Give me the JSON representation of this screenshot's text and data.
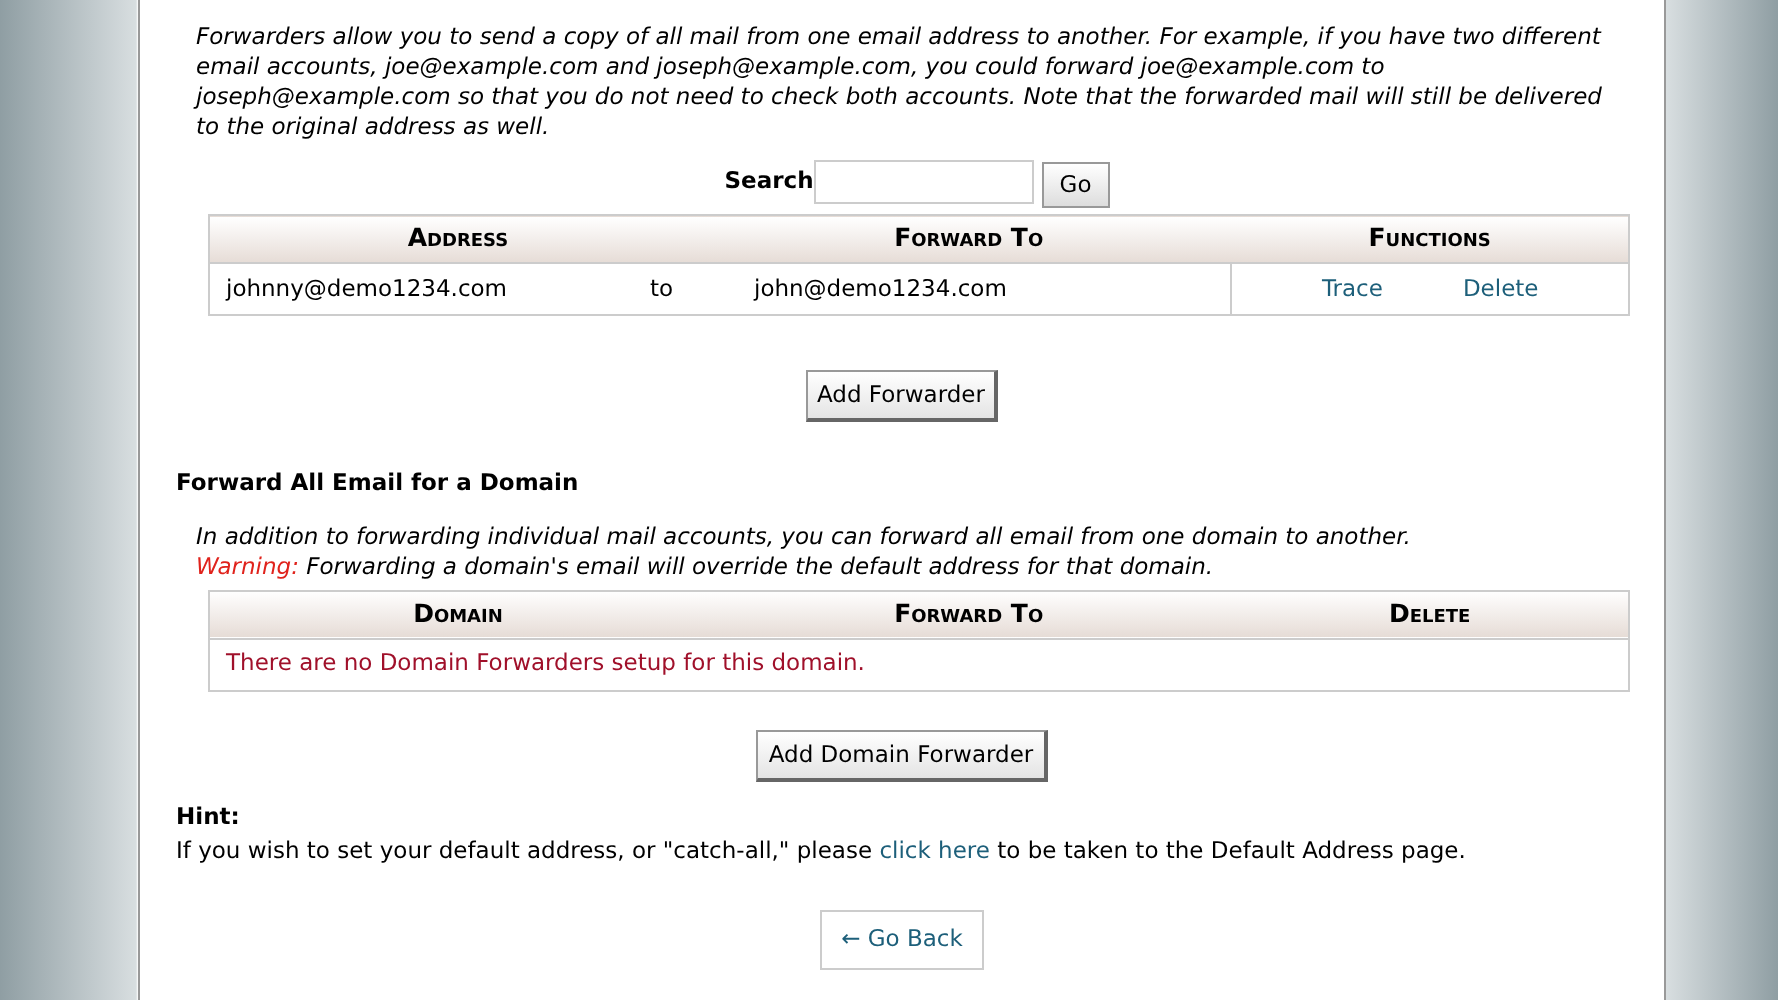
{
  "intro": "Forwarders allow you to send a copy of all mail from one email address to another. For example, if you have two different email accounts, joe@example.com and joseph@example.com, you could forward joe@example.com to joseph@example.com so that you do not need to check both accounts. Note that the forwarded mail will still be delivered to the original address as well.",
  "search": {
    "label": "Search",
    "button": "Go"
  },
  "forwarders": {
    "columns": [
      "Address",
      "Forward To",
      "Functions"
    ],
    "rows": [
      {
        "address": "johnny@demo1234.com",
        "to": "to",
        "forward_to": "john@demo1234.com",
        "actions": [
          "Trace",
          "Delete"
        ]
      }
    ]
  },
  "add_forwarder": "Add Forwarder",
  "domain_section": {
    "title": "Forward All Email for a Domain",
    "text": "In addition to forwarding individual mail accounts, you can forward all email from one domain to another.",
    "warning_label": "Warning:",
    "warning_text": " Forwarding a domain's email will override the default address for that domain.",
    "columns": [
      "Domain",
      "Forward To",
      "Delete"
    ],
    "empty": "There are no Domain Forwarders setup for this domain."
  },
  "add_domain_forwarder": "Add Domain Forwarder",
  "hint": {
    "title": "Hint:",
    "before": "If you wish to set your default address, or \"catch-all,\" please ",
    "link": "click here",
    "after": " to be taken to the Default Address page."
  },
  "back": {
    "arrow": "←",
    "label": "Go Back"
  }
}
